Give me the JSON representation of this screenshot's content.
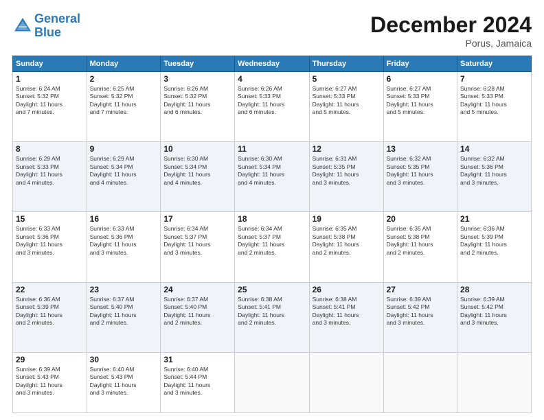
{
  "header": {
    "logo_line1": "General",
    "logo_line2": "Blue",
    "month": "December 2024",
    "location": "Porus, Jamaica"
  },
  "days_of_week": [
    "Sunday",
    "Monday",
    "Tuesday",
    "Wednesday",
    "Thursday",
    "Friday",
    "Saturday"
  ],
  "weeks": [
    [
      {
        "day": 1,
        "info": "Sunrise: 6:24 AM\nSunset: 5:32 PM\nDaylight: 11 hours\nand 7 minutes."
      },
      {
        "day": 2,
        "info": "Sunrise: 6:25 AM\nSunset: 5:32 PM\nDaylight: 11 hours\nand 7 minutes."
      },
      {
        "day": 3,
        "info": "Sunrise: 6:26 AM\nSunset: 5:32 PM\nDaylight: 11 hours\nand 6 minutes."
      },
      {
        "day": 4,
        "info": "Sunrise: 6:26 AM\nSunset: 5:33 PM\nDaylight: 11 hours\nand 6 minutes."
      },
      {
        "day": 5,
        "info": "Sunrise: 6:27 AM\nSunset: 5:33 PM\nDaylight: 11 hours\nand 5 minutes."
      },
      {
        "day": 6,
        "info": "Sunrise: 6:27 AM\nSunset: 5:33 PM\nDaylight: 11 hours\nand 5 minutes."
      },
      {
        "day": 7,
        "info": "Sunrise: 6:28 AM\nSunset: 5:33 PM\nDaylight: 11 hours\nand 5 minutes."
      }
    ],
    [
      {
        "day": 8,
        "info": "Sunrise: 6:29 AM\nSunset: 5:33 PM\nDaylight: 11 hours\nand 4 minutes."
      },
      {
        "day": 9,
        "info": "Sunrise: 6:29 AM\nSunset: 5:34 PM\nDaylight: 11 hours\nand 4 minutes."
      },
      {
        "day": 10,
        "info": "Sunrise: 6:30 AM\nSunset: 5:34 PM\nDaylight: 11 hours\nand 4 minutes."
      },
      {
        "day": 11,
        "info": "Sunrise: 6:30 AM\nSunset: 5:34 PM\nDaylight: 11 hours\nand 4 minutes."
      },
      {
        "day": 12,
        "info": "Sunrise: 6:31 AM\nSunset: 5:35 PM\nDaylight: 11 hours\nand 3 minutes."
      },
      {
        "day": 13,
        "info": "Sunrise: 6:32 AM\nSunset: 5:35 PM\nDaylight: 11 hours\nand 3 minutes."
      },
      {
        "day": 14,
        "info": "Sunrise: 6:32 AM\nSunset: 5:36 PM\nDaylight: 11 hours\nand 3 minutes."
      }
    ],
    [
      {
        "day": 15,
        "info": "Sunrise: 6:33 AM\nSunset: 5:36 PM\nDaylight: 11 hours\nand 3 minutes."
      },
      {
        "day": 16,
        "info": "Sunrise: 6:33 AM\nSunset: 5:36 PM\nDaylight: 11 hours\nand 3 minutes."
      },
      {
        "day": 17,
        "info": "Sunrise: 6:34 AM\nSunset: 5:37 PM\nDaylight: 11 hours\nand 3 minutes."
      },
      {
        "day": 18,
        "info": "Sunrise: 6:34 AM\nSunset: 5:37 PM\nDaylight: 11 hours\nand 2 minutes."
      },
      {
        "day": 19,
        "info": "Sunrise: 6:35 AM\nSunset: 5:38 PM\nDaylight: 11 hours\nand 2 minutes."
      },
      {
        "day": 20,
        "info": "Sunrise: 6:35 AM\nSunset: 5:38 PM\nDaylight: 11 hours\nand 2 minutes."
      },
      {
        "day": 21,
        "info": "Sunrise: 6:36 AM\nSunset: 5:39 PM\nDaylight: 11 hours\nand 2 minutes."
      }
    ],
    [
      {
        "day": 22,
        "info": "Sunrise: 6:36 AM\nSunset: 5:39 PM\nDaylight: 11 hours\nand 2 minutes."
      },
      {
        "day": 23,
        "info": "Sunrise: 6:37 AM\nSunset: 5:40 PM\nDaylight: 11 hours\nand 2 minutes."
      },
      {
        "day": 24,
        "info": "Sunrise: 6:37 AM\nSunset: 5:40 PM\nDaylight: 11 hours\nand 2 minutes."
      },
      {
        "day": 25,
        "info": "Sunrise: 6:38 AM\nSunset: 5:41 PM\nDaylight: 11 hours\nand 2 minutes."
      },
      {
        "day": 26,
        "info": "Sunrise: 6:38 AM\nSunset: 5:41 PM\nDaylight: 11 hours\nand 3 minutes."
      },
      {
        "day": 27,
        "info": "Sunrise: 6:39 AM\nSunset: 5:42 PM\nDaylight: 11 hours\nand 3 minutes."
      },
      {
        "day": 28,
        "info": "Sunrise: 6:39 AM\nSunset: 5:42 PM\nDaylight: 11 hours\nand 3 minutes."
      }
    ],
    [
      {
        "day": 29,
        "info": "Sunrise: 6:39 AM\nSunset: 5:43 PM\nDaylight: 11 hours\nand 3 minutes."
      },
      {
        "day": 30,
        "info": "Sunrise: 6:40 AM\nSunset: 5:43 PM\nDaylight: 11 hours\nand 3 minutes."
      },
      {
        "day": 31,
        "info": "Sunrise: 6:40 AM\nSunset: 5:44 PM\nDaylight: 11 hours\nand 3 minutes."
      },
      null,
      null,
      null,
      null
    ]
  ]
}
